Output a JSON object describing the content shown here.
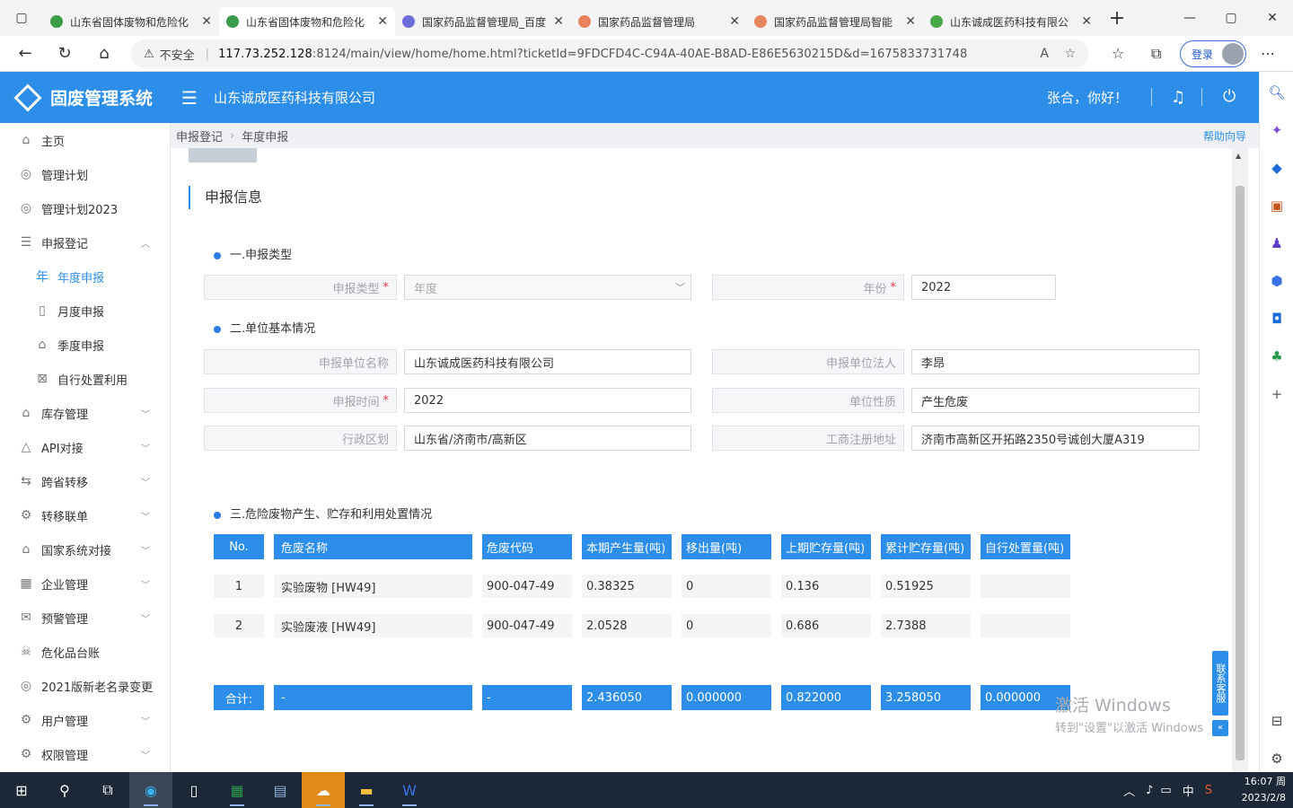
{
  "browser": {
    "tabs": [
      {
        "title": "山东省固体废物和危险化",
        "color": "#3a9b4b",
        "active": false
      },
      {
        "title": "山东省固体废物和危险化",
        "color": "#3a9b4b",
        "active": true
      },
      {
        "title": "国家药品监督管理局_百度",
        "color": "#6c6cd8",
        "active": false
      },
      {
        "title": "国家药品监督管理局",
        "color": "#e8845c",
        "active": false
      },
      {
        "title": "国家药品监督管理局智能",
        "color": "#e8845c",
        "active": false
      },
      {
        "title": "山东诚成医药科技有限公",
        "color": "#4aa84a",
        "active": false
      }
    ],
    "insecure_label": "不安全",
    "url_host": "117.73.252.128",
    "url_rest": ":8124/main/view/home/home.html?ticketId=9FDCFD4C-C94A-40AE-B8AD-E86E5630215D&d=1675833731748",
    "login_label": "登录"
  },
  "header": {
    "app_name": "固废管理系统",
    "company": "山东诚成医药科技有限公司",
    "greeting": "张合，你好！"
  },
  "sidebar": {
    "items": [
      {
        "label": "主页",
        "icon": "home-icon",
        "glyph": "⌂"
      },
      {
        "label": "管理计划",
        "icon": "plan-icon",
        "glyph": "◎"
      },
      {
        "label": "管理计划2023",
        "icon": "plan-icon",
        "glyph": "◎"
      },
      {
        "label": "申报登记",
        "icon": "register-icon",
        "glyph": "☰",
        "chev": "︿"
      },
      {
        "label": "年度申报",
        "icon": "year-icon",
        "glyph": "年",
        "sub": true,
        "active": true
      },
      {
        "label": "月度申报",
        "icon": "month-icon",
        "glyph": "▯",
        "sub": true
      },
      {
        "label": "季度申报",
        "icon": "quarter-icon",
        "glyph": "⌂",
        "sub": true
      },
      {
        "label": "自行处置利用",
        "icon": "dispose-icon",
        "glyph": "⊠",
        "sub": true
      },
      {
        "label": "库存管理",
        "icon": "warehouse-icon",
        "glyph": "⌂",
        "chev": "﹀"
      },
      {
        "label": "API对接",
        "icon": "api-icon",
        "glyph": "△",
        "chev": "﹀"
      },
      {
        "label": "跨省转移",
        "icon": "transfer-icon",
        "glyph": "⇆",
        "chev": "﹀"
      },
      {
        "label": "转移联单",
        "icon": "order-icon",
        "glyph": "⚙",
        "chev": "﹀"
      },
      {
        "label": "国家系统对接",
        "icon": "national-icon",
        "glyph": "⌂",
        "chev": "﹀"
      },
      {
        "label": "企业管理",
        "icon": "enterprise-icon",
        "glyph": "▦",
        "chev": "﹀"
      },
      {
        "label": "预警管理",
        "icon": "warning-icon",
        "glyph": "✉",
        "chev": "﹀"
      },
      {
        "label": "危化品台账",
        "icon": "hazard-icon",
        "glyph": "☠"
      },
      {
        "label": "2021版新老名录变更",
        "icon": "catalog-icon",
        "glyph": "◎"
      },
      {
        "label": "用户管理",
        "icon": "user-icon",
        "glyph": "⚙",
        "chev": "﹀"
      },
      {
        "label": "权限管理",
        "icon": "permission-icon",
        "glyph": "⚙",
        "chev": "﹀"
      }
    ]
  },
  "breadcrumb": {
    "level1": "申报登记",
    "level2": "年度申报",
    "help": "帮助向导"
  },
  "main": {
    "section_title": "申报信息",
    "part1": "一.申报类型",
    "part2": "二.单位基本情况",
    "part3": "三.危险废物产生、贮存和利用处置情况",
    "fields": {
      "report_type": {
        "label": "申报类型",
        "value": "年度"
      },
      "year": {
        "label": "年份",
        "value": "2022"
      },
      "unit_name": {
        "label": "申报单位名称",
        "value": "山东诚成医药科技有限公司"
      },
      "legal_person": {
        "label": "申报单位法人",
        "value": "李昂"
      },
      "report_time": {
        "label": "申报时间",
        "value": "2022"
      },
      "unit_nature": {
        "label": "单位性质",
        "value": "产生危废"
      },
      "region": {
        "label": "行政区划",
        "value": "山东省/济南市/高新区"
      },
      "reg_address": {
        "label": "工商注册地址",
        "value": "济南市高新区开拓路2350号诚创大厦A319"
      }
    },
    "table": {
      "headers": [
        "No.",
        "危废名称",
        "危废代码",
        "本期产生量(吨)",
        "移出量(吨)",
        "上期贮存量(吨)",
        "累计贮存量(吨)",
        "自行处置量(吨)"
      ],
      "rows": [
        [
          "1",
          "实验废物 [HW49]",
          "900-047-49",
          "0.38325",
          "0",
          "0.136",
          "0.51925",
          ""
        ],
        [
          "2",
          "实验废液 [HW49]",
          "900-047-49",
          "2.0528",
          "0",
          "0.686",
          "2.7388",
          ""
        ]
      ],
      "summary": [
        "合计:",
        "-",
        "-",
        "2.436050",
        "0.000000",
        "0.822000",
        "3.258050",
        "0.000000"
      ]
    },
    "contact": "联系客服",
    "watermark_1": "激活 Windows",
    "watermark_2": "转到\"设置\"以激活 Windows"
  },
  "taskbar": {
    "ime": "中",
    "time": "16:07 周",
    "date": "2023/2/8"
  }
}
